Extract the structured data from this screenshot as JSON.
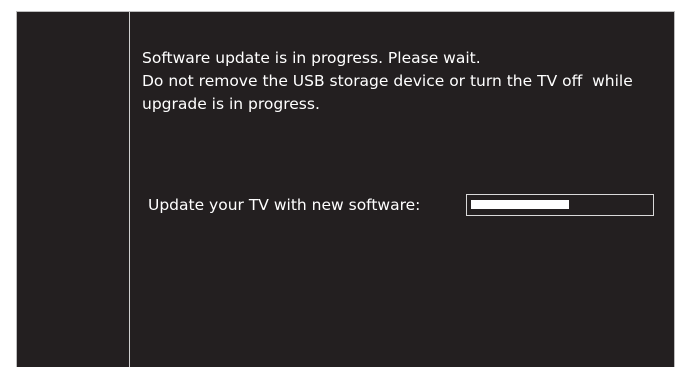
{
  "dialog": {
    "message_line1": "Software update is in progress. Please wait.",
    "message_line2": "Do not remove the USB storage device or turn the TV off  while",
    "message_line3": "upgrade is in progress.",
    "progress_label": "Update your TV with new software:",
    "progress_fraction": 0.55
  },
  "colors": {
    "background": "#231f20",
    "text": "#ffffff",
    "progress_fill": "#ffffff",
    "border": "#cfcfcf"
  }
}
